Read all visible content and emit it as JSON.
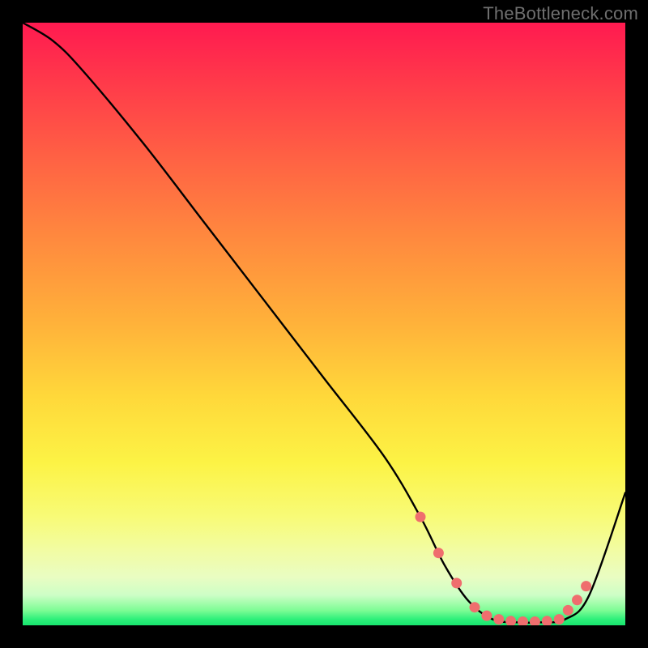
{
  "watermark": "TheBottleneck.com",
  "chart_data": {
    "type": "line",
    "title": "",
    "xlabel": "",
    "ylabel": "",
    "xlim": [
      0,
      100
    ],
    "ylim": [
      0,
      100
    ],
    "series": [
      {
        "name": "curve",
        "x": [
          0,
          5,
          10,
          20,
          30,
          40,
          50,
          60,
          66,
          70,
          74,
          78,
          82,
          86,
          90,
          94,
          100
        ],
        "y": [
          100,
          97,
          92,
          80,
          67,
          54,
          41,
          28,
          18,
          10,
          4,
          1,
          0.5,
          0.5,
          1,
          5,
          22
        ]
      }
    ],
    "markers": {
      "name": "highlight-points",
      "color": "#ef6e6e",
      "x": [
        66,
        69,
        72,
        75,
        77,
        79,
        81,
        83,
        85,
        87,
        89,
        90.5,
        92,
        93.5
      ],
      "y": [
        18,
        12,
        7,
        3,
        1.6,
        1,
        0.7,
        0.6,
        0.6,
        0.7,
        1,
        2.5,
        4.2,
        6.5
      ]
    }
  }
}
